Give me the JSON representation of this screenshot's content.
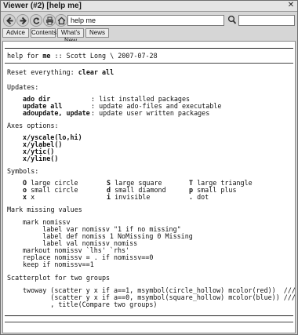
{
  "window": {
    "title": "Viewer (#2) [help me]",
    "close_glyph": "✕"
  },
  "toolbar": {
    "url_value": "help me",
    "search_value": ""
  },
  "nav": {
    "advice": "Advice",
    "contents": "Contents",
    "whats_new": "What's New",
    "news": "News"
  },
  "doc": {
    "header_prefix": "help for ",
    "header_cmd": "me",
    "header_suffix": " :: Scott Long \\ 2007-07-28",
    "reset_prefix": "Reset everything: ",
    "reset_cmd": "clear all",
    "updates_heading": "Updates:",
    "updates": [
      {
        "cmd": "ado dir",
        "desc": ": list installed packages"
      },
      {
        "cmd": "update all",
        "desc": ": update ado-files and executable"
      },
      {
        "cmd": "adoupdate, update",
        "desc": ": update user written packages"
      }
    ],
    "axes_heading": "Axes options:",
    "axes": [
      "x/yscale(lo,hi)",
      "x/ylabel()",
      "x/ytic()",
      "x/yline()"
    ],
    "symbols_heading": "Symbols:",
    "symbols": [
      [
        {
          "key": "O",
          "desc": " large circle"
        },
        {
          "key": "S",
          "desc": " large square"
        },
        {
          "key": "T",
          "desc": " large triangle"
        }
      ],
      [
        {
          "key": "o",
          "desc": " small circle"
        },
        {
          "key": "d",
          "desc": " small diamond"
        },
        {
          "key": "p",
          "desc": " small plus"
        }
      ],
      [
        {
          "key": "x",
          "desc": " x"
        },
        {
          "key": "i",
          "desc": " invisible"
        },
        {
          "key": ".",
          "desc": " dot"
        }
      ]
    ],
    "missing_heading": "Mark missing values",
    "missing_lines": [
      "mark nomissv",
      "     label var nomissv \"1 if no missing\"",
      "     label def nomiss 1 NoMissing 0 Missing",
      "     label val nomissv nomiss",
      "markout nomissv `lhs' `rhs'",
      "replace nomissv = . if nomissv==0",
      "keep if nomissv==1"
    ],
    "scatter_heading": "Scatterplot for two groups",
    "scatter_lines": [
      "twoway (scatter y x if a==1, msymbol(circle_hollow) mcolor(red))  ///",
      "       (scatter y x if a==0, msymbol(square_hollow) mcolor(blue)) ///",
      "       , title(Compare two groups)"
    ]
  },
  "icons": {
    "back": "arrow-left-icon",
    "forward": "arrow-right-icon",
    "refresh": "refresh-icon",
    "print": "print-icon",
    "home": "home-icon",
    "search": "search-icon"
  }
}
